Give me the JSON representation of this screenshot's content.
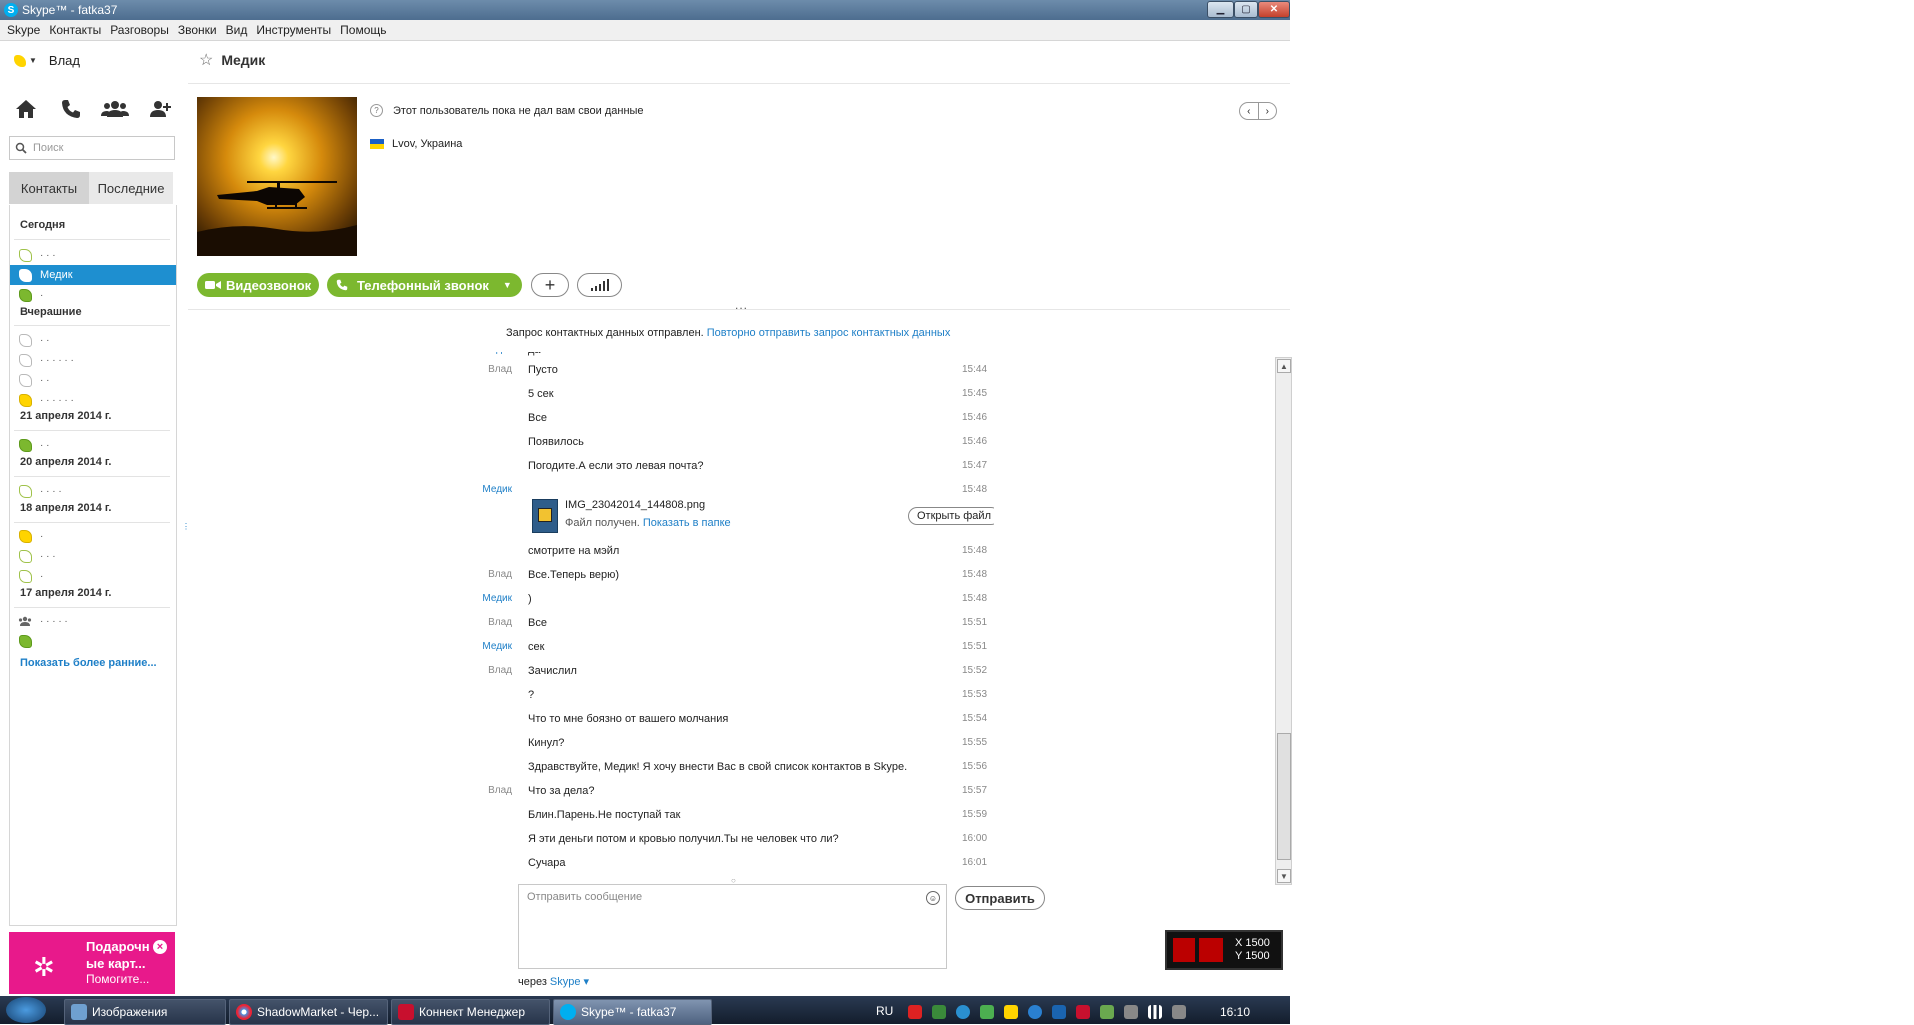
{
  "window": {
    "title": "Skype™ - fatka37",
    "logo_letter": "S",
    "minimize": "▁",
    "maximize": "▢",
    "close": "✕"
  },
  "menu": [
    "Skype",
    "Контакты",
    "Разговоры",
    "Звонки",
    "Вид",
    "Инструменты",
    "Помощь"
  ],
  "user": {
    "name": "Влад",
    "status_color": "#ffd400"
  },
  "search": {
    "placeholder": "Поиск"
  },
  "tabs": {
    "contacts": "Контакты",
    "recent": "Последние"
  },
  "contacts_list": {
    "today": "Сегодня",
    "yesterday": "Вчерашние",
    "apr21": "21 апреля 2014 г.",
    "apr20": "20 апреля 2014 г.",
    "apr18": "18 апреля 2014 г.",
    "apr17": "17 апреля 2014 г.",
    "selected": "Медик",
    "show_more": "Показать более ранние..."
  },
  "gift": {
    "title": "Подарочные карт...",
    "title_l1": "Подарочн",
    "title_l2": "ые карт...",
    "subtitle": "Помогите...",
    "close": "×"
  },
  "chat": {
    "name": "Медик",
    "mood": "Этот пользователь пока не дал вам свои данные",
    "location": "Lvov, Украина",
    "video_call": "Видеозвонок",
    "phone_call": "Телефонный звонок",
    "add": "+",
    "dots": "...",
    "notice": "Запрос контактных данных отправлен.",
    "notice_link": "Повторно отправить запрос контактных данных"
  },
  "messages": [
    {
      "sender": "Влад",
      "text": "Пусто",
      "time": "15:44"
    },
    {
      "sender": "",
      "text": "5 сек",
      "time": "15:45"
    },
    {
      "sender": "",
      "text": "Все",
      "time": "15:46"
    },
    {
      "sender": "",
      "text": "Появилось",
      "time": "15:46"
    },
    {
      "sender": "",
      "text": "Погодите.А если это левая почта?",
      "time": "15:47"
    },
    {
      "sender": "Медик",
      "text": "",
      "time": "15:48"
    },
    {
      "sender": "",
      "text": "смотрите на мэйл",
      "time": "15:48"
    },
    {
      "sender": "Влад",
      "text": "Все.Теперь верю)",
      "time": "15:48"
    },
    {
      "sender": "Медик",
      "text": ")",
      "time": "15:48"
    },
    {
      "sender": "Влад",
      "text": "Все",
      "time": "15:51"
    },
    {
      "sender": "Медик",
      "text": "сек",
      "time": "15:51"
    },
    {
      "sender": "Влад",
      "text": "Зачислил",
      "time": "15:52"
    },
    {
      "sender": "",
      "text": "?",
      "time": "15:53"
    },
    {
      "sender": "",
      "text": "Что то мне боязно от вашего молчания",
      "time": "15:54"
    },
    {
      "sender": "",
      "text": "Кинул?",
      "time": "15:55"
    },
    {
      "sender": "",
      "text": "Здравствуйте, Медик! Я хочу внести Вас в свой список контактов в Skype.",
      "time": "15:56"
    },
    {
      "sender": "Влад",
      "text": "Что за дела?",
      "time": "15:57"
    },
    {
      "sender": "",
      "text": "Блин.Парень.Не поступай так",
      "time": "15:59"
    },
    {
      "sender": "",
      "text": "Я эти деньги потом и кровью получил.Ты не человек что ли?",
      "time": "16:00"
    },
    {
      "sender": "",
      "text": "Сучара",
      "time": "16:01"
    }
  ],
  "file": {
    "name": "IMG_23042014_144808.png",
    "status": "Файл получен.",
    "show_folder": "Показать в папке",
    "open": "Открыть файл"
  },
  "compose": {
    "placeholder": "Отправить сообщение",
    "send": "Отправить",
    "via": "через",
    "via_link": "Skype ▾"
  },
  "overlay": {
    "x": "X 1500",
    "y": "Y 1500"
  },
  "taskbar": {
    "tasks": [
      "Изображения",
      "ShadowMarket - Чер...",
      "Коннект Менеджер",
      "Skype™ - fatka37"
    ],
    "lang": "RU",
    "clock": "16:10"
  }
}
